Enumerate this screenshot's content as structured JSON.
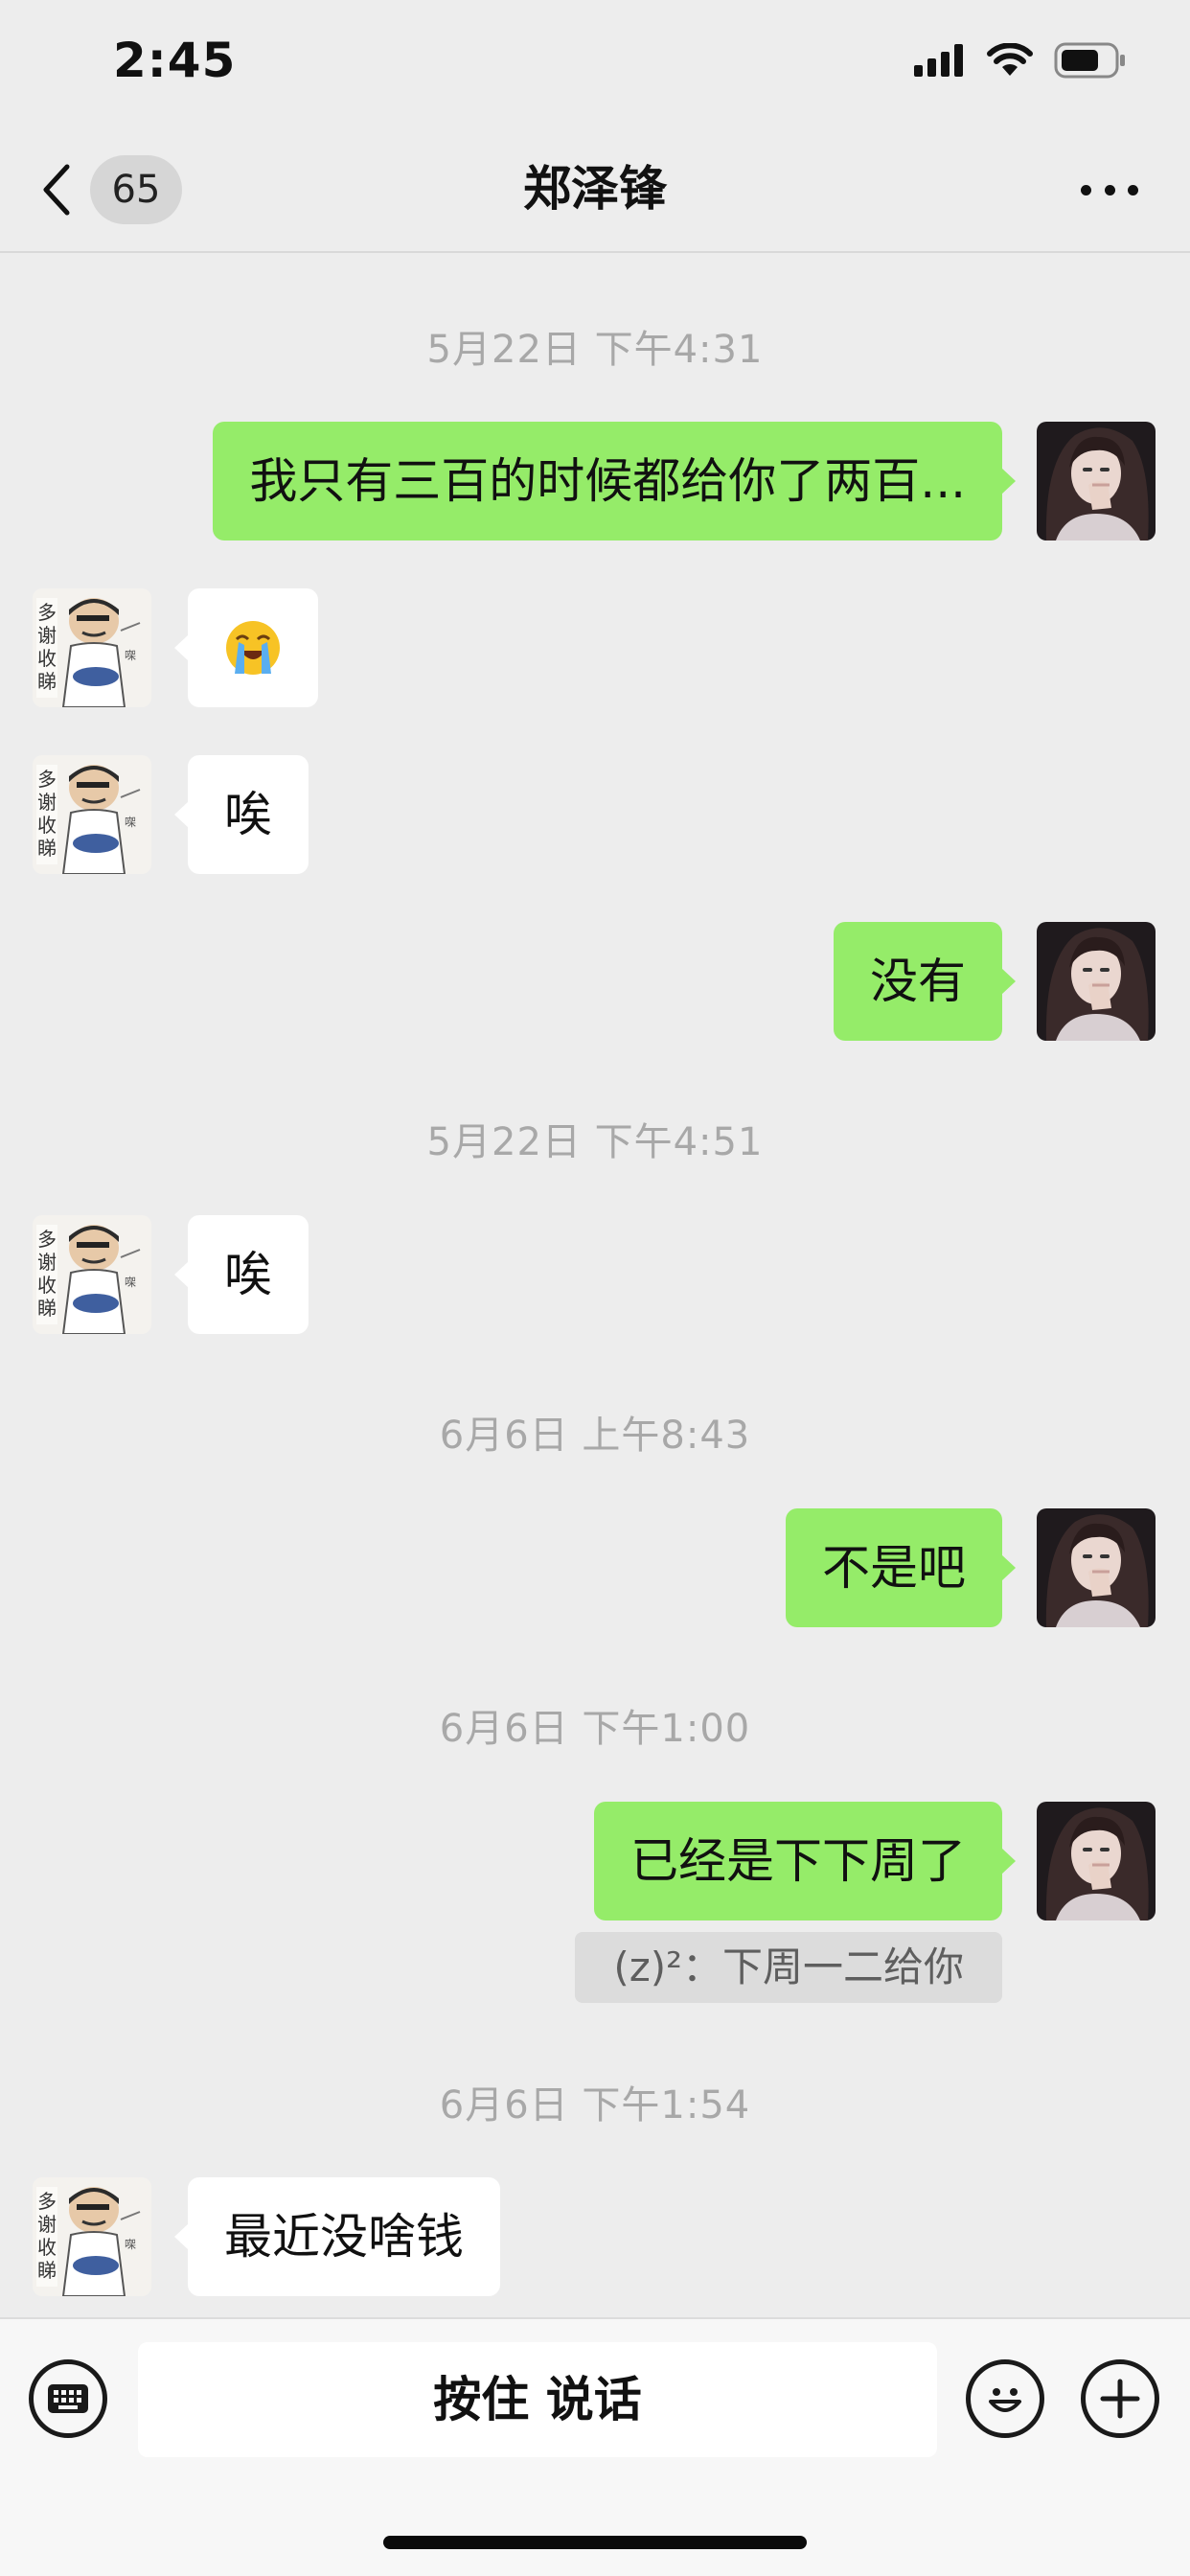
{
  "status_bar": {
    "time": "2:45"
  },
  "nav": {
    "unread_count": "65",
    "title": "郑泽锋"
  },
  "messages": [
    {
      "kind": "timestamp",
      "text": "5月22日 下午4:31"
    },
    {
      "kind": "sent",
      "text": "我只有三百的时候都给你了两百..."
    },
    {
      "kind": "received",
      "text": "😭",
      "emoji": "loudly-crying-face"
    },
    {
      "kind": "received",
      "text": "唉"
    },
    {
      "kind": "sent",
      "text": "没有"
    },
    {
      "kind": "timestamp",
      "text": "5月22日 下午4:51"
    },
    {
      "kind": "received",
      "text": "唉"
    },
    {
      "kind": "timestamp",
      "text": "6月6日 上午8:43"
    },
    {
      "kind": "sent",
      "text": "不是吧"
    },
    {
      "kind": "timestamp",
      "text": "6月6日 下午1:00"
    },
    {
      "kind": "sent",
      "text": "已经是下下周了"
    },
    {
      "kind": "quote",
      "text": "(z)²：下周一二给你"
    },
    {
      "kind": "timestamp",
      "text": "6月6日 下午1:54"
    },
    {
      "kind": "received",
      "text": "最近没啥钱"
    }
  ],
  "input_bar": {
    "hold_to_talk_label": "按住 说话",
    "left_icon": "keyboard-icon",
    "right_icons": [
      "emoji-icon",
      "plus-icon"
    ]
  },
  "colors": {
    "background": "#ededed",
    "sent_bubble": "#95ec69",
    "received_bubble": "#ffffff",
    "timestamp_text": "#a8a8a8"
  }
}
